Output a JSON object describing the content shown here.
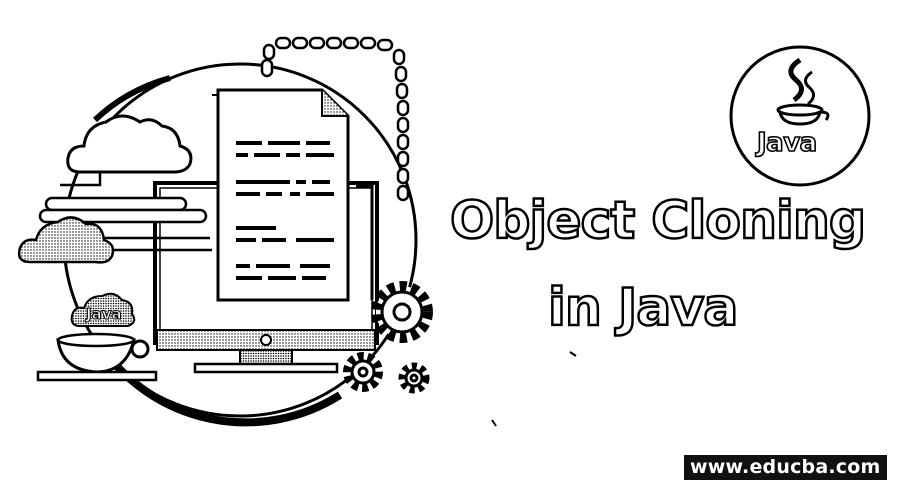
{
  "title": {
    "line1": "Object Cloning",
    "line2": "in Java"
  },
  "logo": {
    "text": "Java",
    "icon": "java-coffee-cup-icon"
  },
  "illustration": {
    "cup_label": "Java",
    "icons": [
      "cloud-icon",
      "monitor-icon",
      "document-icon",
      "gear-icon",
      "chain-icon",
      "coffee-cup-icon"
    ]
  },
  "watermark": {
    "text": "www.educba.com"
  },
  "colors": {
    "background": "#ffffff",
    "ink": "#000000",
    "fill": "#ffffff"
  }
}
